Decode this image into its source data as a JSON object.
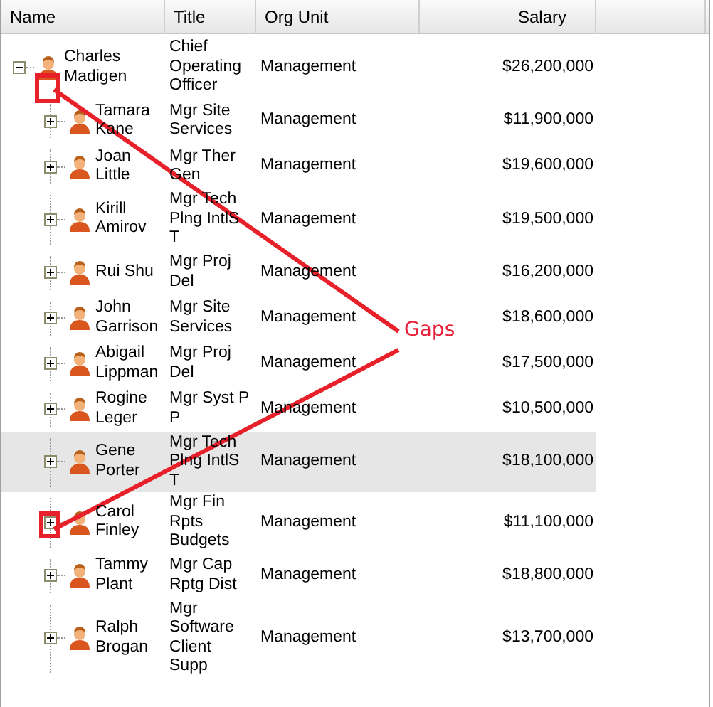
{
  "table": {
    "columns": [
      "Name",
      "Title",
      "Org Unit",
      "Salary"
    ],
    "rows": [
      {
        "name": "Charles Madigen",
        "title": "Chief Operating Officer",
        "org_unit": "Management",
        "salary": "$26,200,000",
        "expanded": true,
        "selected": false,
        "children": [
          {
            "name": "Tamara Kane",
            "title": "Mgr Site Services",
            "org_unit": "Management",
            "salary": "$11,900,000",
            "expanded": false,
            "selected": false
          },
          {
            "name": "Joan Little",
            "title": "Mgr Ther Gen",
            "org_unit": "Management",
            "salary": "$19,600,000",
            "expanded": false,
            "selected": false
          },
          {
            "name": "Kirill Amirov",
            "title": "Mgr Tech Plng IntlS T",
            "org_unit": "Management",
            "salary": "$19,500,000",
            "expanded": false,
            "selected": false
          },
          {
            "name": "Rui Shu",
            "title": "Mgr Proj Del",
            "org_unit": "Management",
            "salary": "$16,200,000",
            "expanded": false,
            "selected": false
          },
          {
            "name": "John Garrison",
            "title": "Mgr Site Services",
            "org_unit": "Management",
            "salary": "$18,600,000",
            "expanded": false,
            "selected": false
          },
          {
            "name": "Abigail Lippman",
            "title": "Mgr Proj Del",
            "org_unit": "Management",
            "salary": "$17,500,000",
            "expanded": false,
            "selected": false
          },
          {
            "name": "Rogine Leger",
            "title": "Mgr Syst P P",
            "org_unit": "Management",
            "salary": "$10,500,000",
            "expanded": false,
            "selected": false
          },
          {
            "name": "Gene Porter",
            "title": "Mgr Tech Plng IntlS T",
            "org_unit": "Management",
            "salary": "$18,100,000",
            "expanded": false,
            "selected": true
          },
          {
            "name": "Carol Finley",
            "title": "Mgr Fin Rpts Budgets",
            "org_unit": "Management",
            "salary": "$11,100,000",
            "expanded": false,
            "selected": false
          },
          {
            "name": "Tammy Plant",
            "title": "Mgr Cap Rptg Dist",
            "org_unit": "Management",
            "salary": "$18,800,000",
            "expanded": false,
            "selected": false
          },
          {
            "name": "Ralph Brogan",
            "title": "Mgr Software Client Supp",
            "org_unit": "Management",
            "salary": "$13,700,000",
            "expanded": false,
            "selected": false
          }
        ]
      }
    ]
  },
  "annotation": {
    "label": "Gaps"
  }
}
